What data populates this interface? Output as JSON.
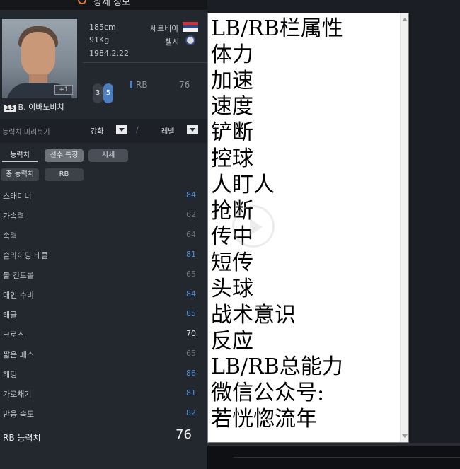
{
  "game": {
    "header_title": "상세 정보",
    "player": {
      "number": "15",
      "name": "B. 이바노비치",
      "height": "185cm",
      "weight": "91Kg",
      "birth": "1984.2.22",
      "nation": "세르비아",
      "club": "첼시",
      "plus_badge": "+1",
      "foot_left": "3",
      "foot_right": "5",
      "position": "RB",
      "position_rating": "76"
    },
    "preview": {
      "label": "능력치 미리보기",
      "enhance": "강화",
      "separator": "/",
      "level": "레벨"
    },
    "tabs": {
      "stats": "능력치",
      "traits": "선수 특징",
      "market": "시세"
    },
    "filters": {
      "total": "총 능력치",
      "position": "RB"
    },
    "stats": [
      {
        "name": "스태미너",
        "value": "84",
        "color": "#4f8fd6"
      },
      {
        "name": "가속력",
        "value": "62",
        "color": "#6e747d"
      },
      {
        "name": "속력",
        "value": "64",
        "color": "#6e747d"
      },
      {
        "name": "슬라이딩 태클",
        "value": "81",
        "color": "#4f8fd6"
      },
      {
        "name": "볼 컨트롤",
        "value": "65",
        "color": "#6e747d"
      },
      {
        "name": "대인 수비",
        "value": "84",
        "color": "#4f8fd6"
      },
      {
        "name": "태클",
        "value": "85",
        "color": "#4f8fd6"
      },
      {
        "name": "크로스",
        "value": "70",
        "color": "#e4e6e9"
      },
      {
        "name": "짧은 패스",
        "value": "65",
        "color": "#6e747d"
      },
      {
        "name": "헤딩",
        "value": "86",
        "color": "#4f8fd6"
      },
      {
        "name": "가로채기",
        "value": "81",
        "color": "#4f8fd6"
      },
      {
        "name": "반응 속도",
        "value": "82",
        "color": "#4f8fd6"
      }
    ],
    "total_label": "RB 능력치",
    "total_value": "76"
  },
  "notepad": {
    "lines": [
      "LB/RB栏属性",
      "体力",
      "加速",
      "速度",
      "铲断",
      "控球",
      "人盯人",
      "抢断",
      "传中",
      "短传",
      "头球",
      "战术意识",
      "反应",
      "LB/RB总能力",
      "微信公众号:",
      "若恍惚流年"
    ]
  }
}
